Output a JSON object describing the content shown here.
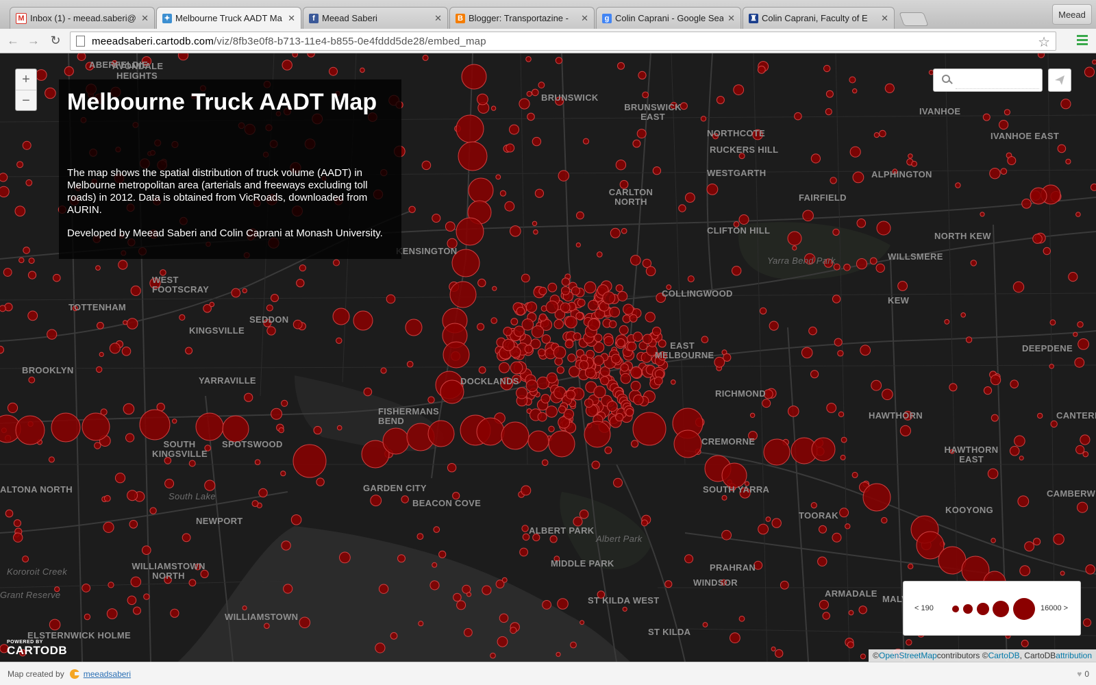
{
  "browser": {
    "tabs": [
      {
        "title": "Inbox (1) - meead.saberi@",
        "icon": "gmail-icon",
        "color": "#d93025",
        "glyph": "M",
        "active": false
      },
      {
        "title": "Melbourne Truck AADT Ma",
        "icon": "cartodb-icon",
        "color": "#3d8fd1",
        "glyph": "✦",
        "active": true
      },
      {
        "title": "Meead Saberi",
        "icon": "facebook-icon",
        "color": "#3b5998",
        "glyph": "f",
        "active": false
      },
      {
        "title": "Blogger: Transportazine -",
        "icon": "blogger-icon",
        "color": "#f57d00",
        "glyph": "B",
        "active": false
      },
      {
        "title": "Colin Caprani - Google Sea",
        "icon": "google-icon",
        "color": "#4285f4",
        "glyph": "g",
        "active": false
      },
      {
        "title": "Colin Caprani, Faculty of E",
        "icon": "monash-icon",
        "color": "#1a3e8c",
        "glyph": "♜",
        "active": false
      }
    ],
    "close_glyph": "✕",
    "profile_name": "Meead",
    "url_host": "meeadsaberi.cartodb.com",
    "url_path": "/viz/8fb3e0f8-b713-11e4-b855-0e4fddd5de28/embed_map",
    "back_glyph": "←",
    "forward_glyph": "→",
    "reload_glyph": "↻",
    "star_glyph": "☆"
  },
  "map": {
    "title": "Melbourne Truck AADT Map",
    "description_1": "The map shows the spatial distribution of truck volume (AADT) in Melbourne metropolitan area (arterials and freeways excluding toll roads) in 2012. Data is obtained from VicRoads, downloaded from AURIN.",
    "description_2": "Developed by Meead Saberi and Colin Caprani at Monash University.",
    "zoom_in": "+",
    "zoom_out": "−",
    "search_placeholder": "",
    "legend_low": "< 190",
    "legend_high": "16000 >",
    "powered_by": "POWERED BY",
    "powered_brand": "CARTODB",
    "attribution": {
      "prefix": "© ",
      "osm": "OpenStreetMap",
      "mid": " contributors © ",
      "cartodb": "CartoDB",
      "mid2": ", CartoDB ",
      "attr_link": "attribution"
    },
    "bubble_color": "#8b0000",
    "bubble_stroke": "#d04040",
    "place_labels": [
      "ABERFELDIE",
      "AVONDALE HEIGHTS",
      "BRUNSWICK",
      "BRUNSWICK EAST",
      "IVANHOE",
      "IVANHOE EAST",
      "NORTHCOTE",
      "RUCKERS HILL",
      "WESTGARTH",
      "ALPHINGTON",
      "FAIRFIELD",
      "CARLTON NORTH",
      "CLIFTON HILL",
      "NORTH KEW",
      "KENSINGTON",
      "WILLSMERE",
      "Yarra Bend Park",
      "WEST FOOTSCRAY",
      "COLLINGWOOD",
      "KEW",
      "TOTTENHAM",
      "SEDDON",
      "KINGSVILLE",
      "EAST MELBOURNE",
      "DEEPDENE",
      "BROOKLYN",
      "YARRAVILLE",
      "DOCKLANDS",
      "RICHMOND",
      "FISHERMANS BEND",
      "HAWTHORN",
      "CANTERBURY",
      "SOUTH KINGSVILLE",
      "SPOTSWOOD",
      "CREMORNE",
      "HAWTHORN EAST",
      "ALTONA NORTH",
      "GARDEN CITY",
      "SOUTH YARRA",
      "KOOYONG",
      "CAMBERWELL",
      "South Lake",
      "NEWPORT",
      "BEACON COVE",
      "TOORAK",
      "ALBERT PARK",
      "Albert Park",
      "Kororoit Creek",
      "WILLIAMSTOWN NORTH",
      "MIDDLE PARK",
      "PRAHRAN",
      "WINDSOR",
      "ARMADALE",
      "ST KILDA WEST",
      "MALVERN",
      "WILLIAMSTOWN",
      "ST KILDA",
      "Grant Reserve",
      "ELSTERNWICK HOLME"
    ]
  }
}
